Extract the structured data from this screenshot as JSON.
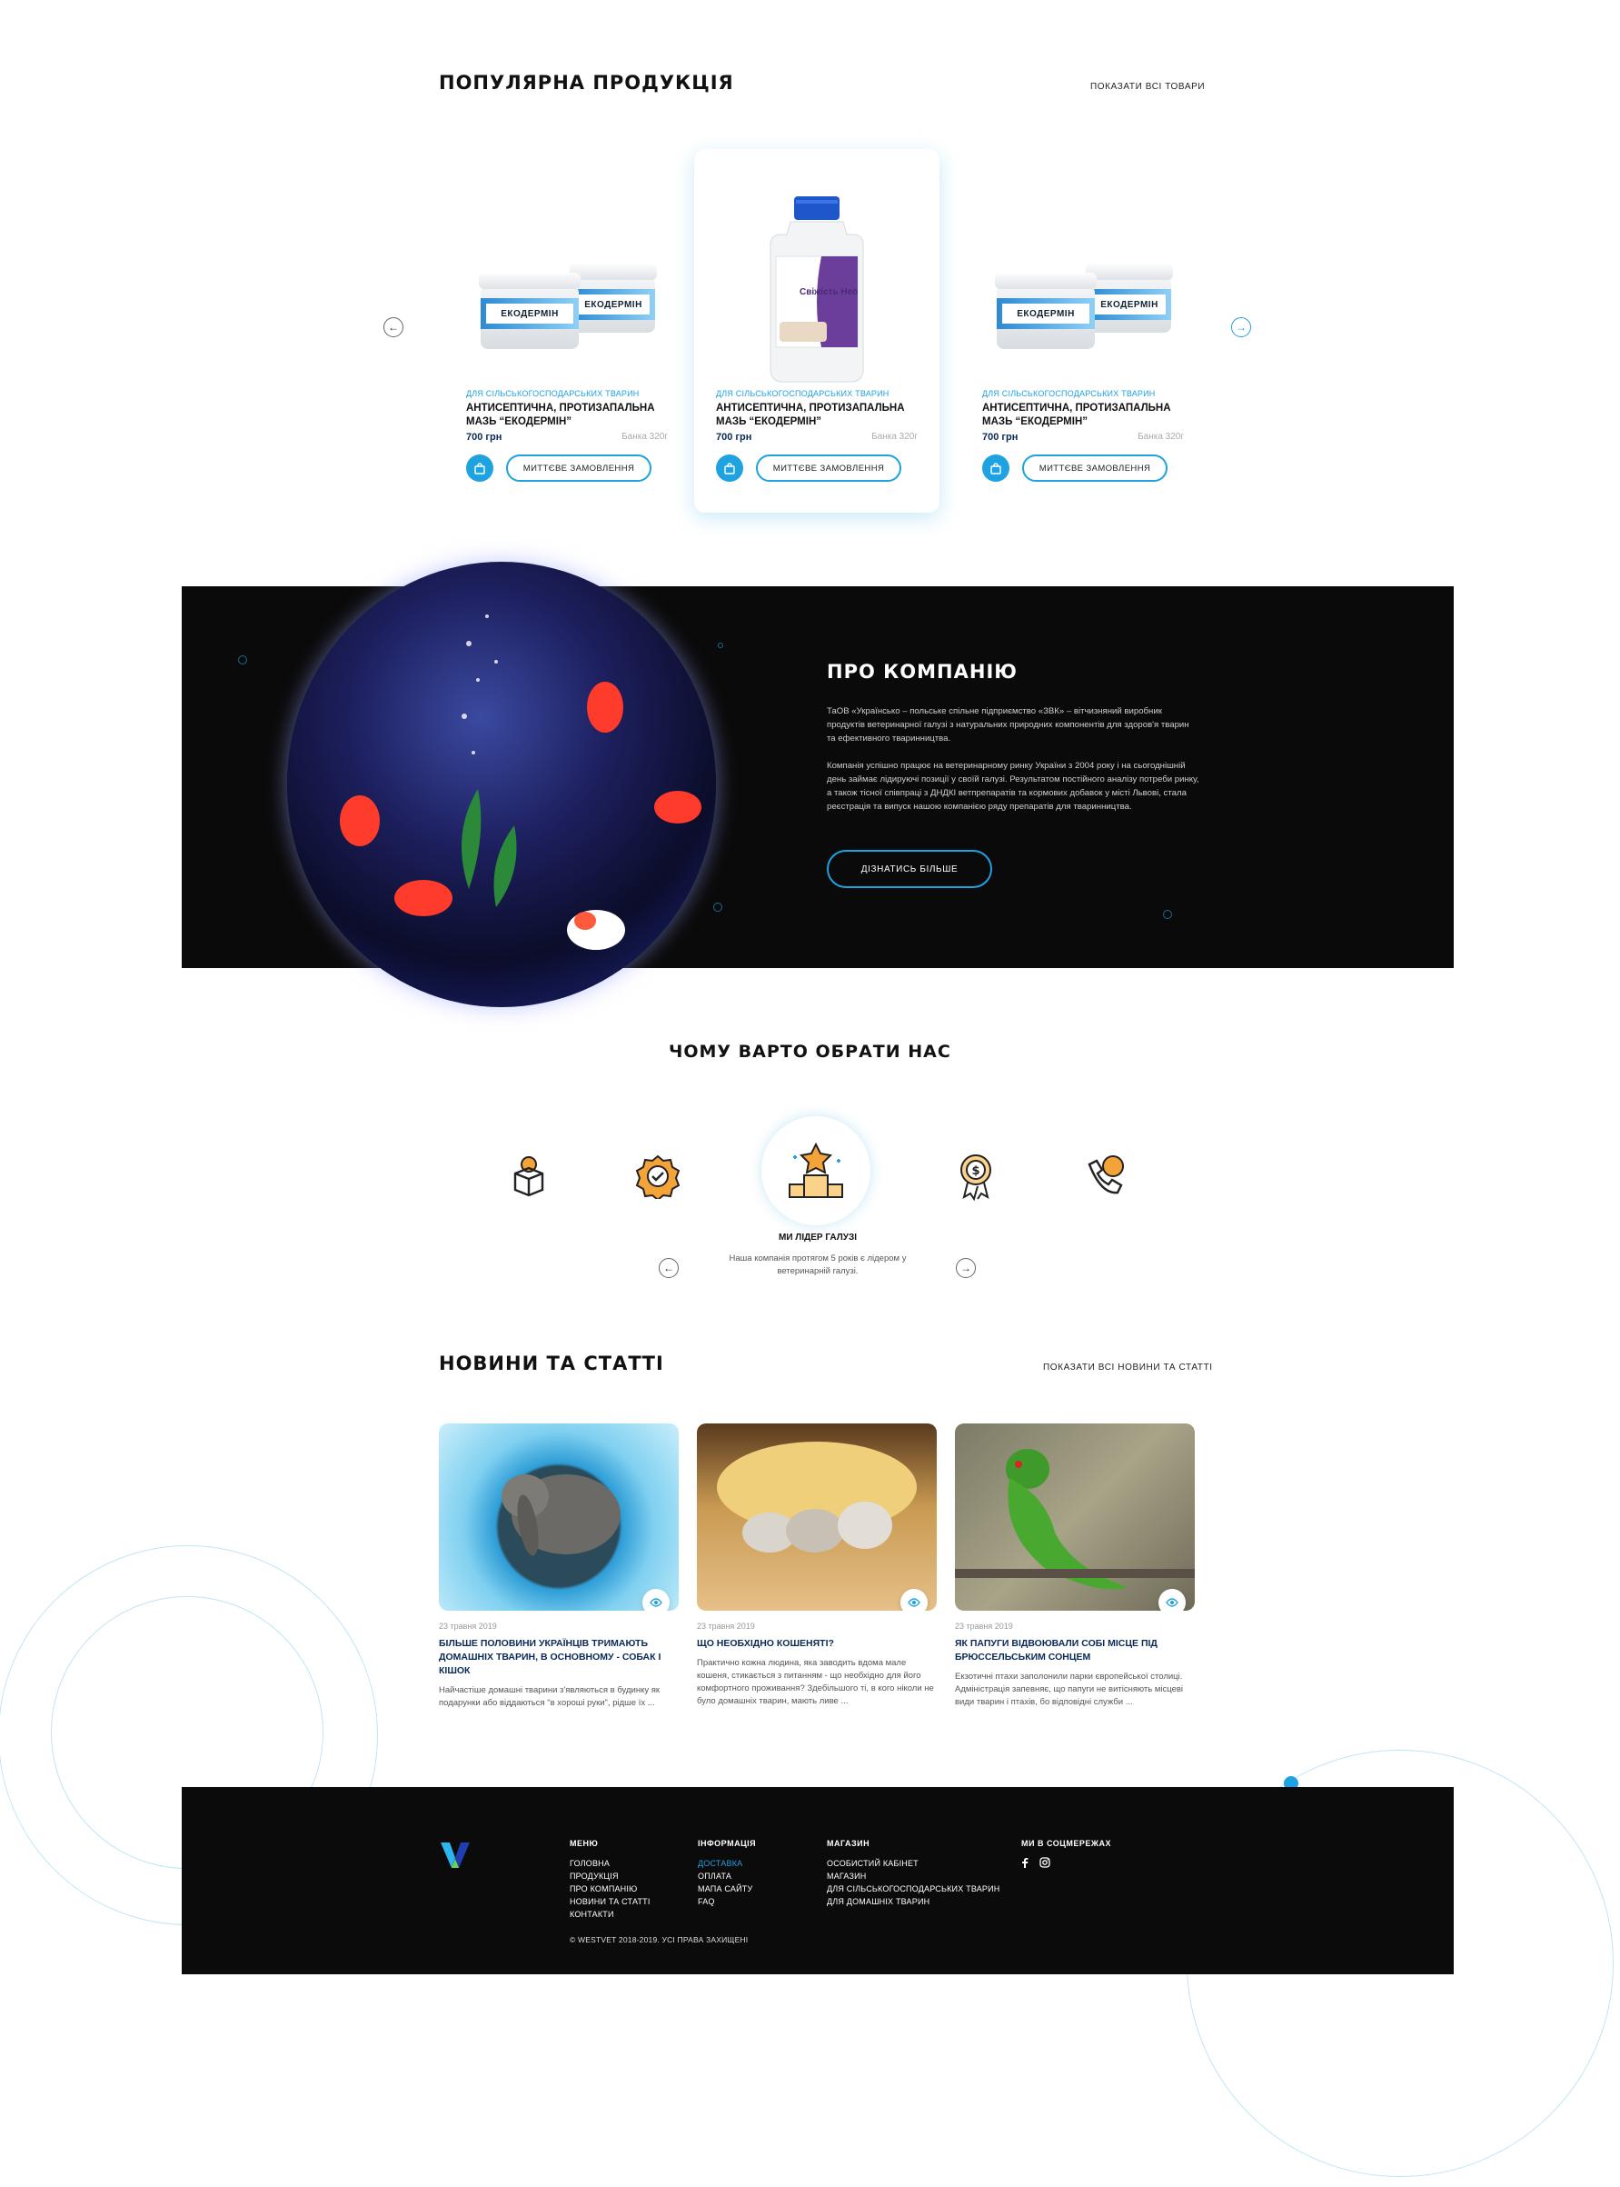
{
  "colors": {
    "accent": "#1ea2e0",
    "dark": "#0a0a0a",
    "navy": "#0a2a55"
  },
  "popular": {
    "title": "ПОПУЛЯРНА ПРОДУКЦІЯ",
    "show_all": "ПОКАЗАТИ ВСІ ТОВАРИ",
    "products": [
      {
        "category": "Для сільськогосподарських тварин",
        "name": "Антисептична, протизапальна мазь “ЕКОДЕРМІН”",
        "price": "700 грн",
        "size": "Банка 320г",
        "order": "Миттєве замовлення",
        "jar_label": "ЕКОДЕРМІН"
      },
      {
        "category": "Для сільськогосподарських тварин",
        "name": "Антисептична, протизапальна мазь “ЕКОДЕРМІН”",
        "price": "700 грн",
        "size": "Банка 320г",
        "order": "Миттєве замовлення",
        "bottle_label": "Свіжість Нео"
      },
      {
        "category": "Для сільськогосподарських тварин",
        "name": "Антисептична, протизапальна мазь “ЕКОДЕРМІН”",
        "price": "700 грн",
        "size": "Банка 320г",
        "order": "Миттєве замовлення",
        "jar_label": "ЕКОДЕРМІН"
      }
    ]
  },
  "about": {
    "title": "ПРО КОМПАНІЮ",
    "p1": "ТаОВ «Українсько – польське спільне підприємство «ЗВК» – вітчизняний виробник продуктів ветеринарної галузі з натуральних природних компонентів для здоров'я тварин та ефективного тваринництва.",
    "p2": "Компанія успішно працює на ветеринарному ринку України з 2004 року і на сьогоднішній день займає лідируючі позиції у своїй галузі. Результатом постійного аналізу потреби ринку, а також тісної співпраці з ДНДКІ ветпрепаратів та кормових добавок у місті Львові, стала реєстрація та випуск нашою компанією ряду препаратів для тваринництва.",
    "button": "Дізнатись більше"
  },
  "why": {
    "title": "ЧОМУ ВАРТО ОБРАТИ НАС",
    "feature_title": "МИ ЛІДЕР ГАЛУЗІ",
    "feature_text": "Наша компанія протягом 5 років є лідером у ветеринарній галузі.",
    "icons": [
      "gift-box-icon",
      "quality-badge-icon",
      "podium-star-icon",
      "price-medal-icon",
      "phone-support-icon"
    ]
  },
  "news": {
    "title": "НОВИНИ ТА СТАТТІ",
    "show_all": "ПОКАЗАТИ ВСІ НОВИНИ ТА СТАТТІ",
    "items": [
      {
        "date": "23 травня 2019",
        "title": "Більше половини українців тримають домашніх тварин, в основному - собак і кішок",
        "text": "Найчастіше домашні тварини з'являються в будинку як подарунки або віддаються \"в хороші руки\", рідше їх ..."
      },
      {
        "date": "23 травня 2019",
        "title": "Що необхідно кошеняті?",
        "text": "Практично кожна людина, яка заводить вдома мале кошеня, стикається з питанням - що необхідно для його комфортного проживання? Здебільшого ті, в кого ніколи не було домашніх тварин, мають ливе ..."
      },
      {
        "date": "23 травня 2019",
        "title": "Як папуги відвоювали собі місце під брюссельським сонцем",
        "text": "Екзотичні птахи заполонили парки європейської столиці. Адміністрація запевняє, що папуги не витісняють місцеві види тварин і птахів, бо відповідні служби ..."
      }
    ]
  },
  "footer": {
    "menu": {
      "title": "Меню",
      "items": [
        "Головна",
        "Продукція",
        "Про компанію",
        "Новини та статті",
        "Контакти"
      ]
    },
    "info": {
      "title": "Інформація",
      "items": [
        "Доставка",
        "Оплата",
        "Мапа сайту",
        "FAQ"
      ]
    },
    "shop": {
      "title": "Магазин",
      "items": [
        "Особистий кабінет",
        "Магазин",
        "Для сільськогосподарських тварин",
        "Для домашніх тварин"
      ]
    },
    "social": {
      "title": "Ми в соцмережах"
    },
    "copyright": "© WESTVET 2018-2019. Усі права захищені"
  }
}
